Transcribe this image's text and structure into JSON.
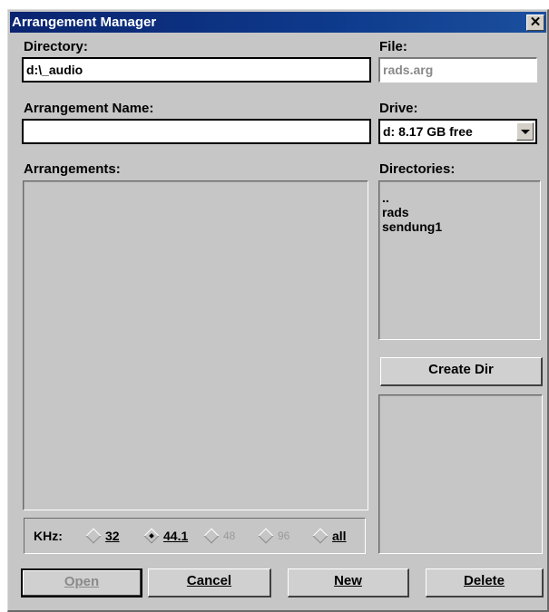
{
  "window": {
    "title": "Arrangement Manager",
    "close_glyph": "✕"
  },
  "directory": {
    "label": "Directory:",
    "value": "d:\\_audio"
  },
  "file": {
    "label": "File:",
    "value": "rads.arg"
  },
  "arrangement_name": {
    "label": "Arrangement Name:",
    "value": ""
  },
  "drive": {
    "label": "Drive:",
    "value": "d: 8.17 GB free"
  },
  "arrangements": {
    "label": "Arrangements:",
    "items": []
  },
  "directories": {
    "label": "Directories:",
    "items": [
      "..",
      "rads",
      "sendung1"
    ]
  },
  "create_dir": {
    "label": "Create Dir"
  },
  "khz": {
    "label": "KHz:",
    "options": [
      {
        "label": "32",
        "selected": false,
        "enabled": true
      },
      {
        "label": "44.1",
        "selected": true,
        "enabled": true
      },
      {
        "label": "48",
        "selected": false,
        "enabled": false
      },
      {
        "label": "96",
        "selected": false,
        "enabled": false
      },
      {
        "label": "all",
        "selected": false,
        "enabled": true
      }
    ]
  },
  "buttons": {
    "open": {
      "label": "Open",
      "enabled": false
    },
    "cancel": {
      "label": "Cancel"
    },
    "new": {
      "label": "New"
    },
    "delete": {
      "label": "Delete"
    }
  }
}
